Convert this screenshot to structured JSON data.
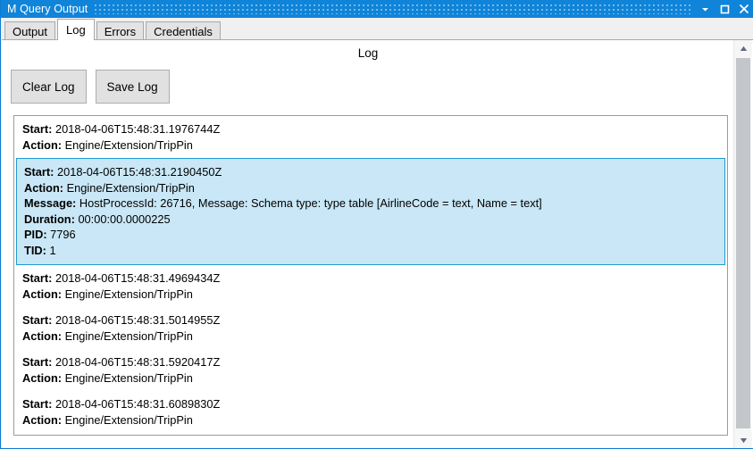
{
  "window": {
    "title": "M Query Output",
    "controls": [
      {
        "name": "minimize-button",
        "glyph": "chevron-down"
      },
      {
        "name": "maximize-button",
        "glyph": "square"
      },
      {
        "name": "close-button",
        "glyph": "x"
      }
    ]
  },
  "tabs": [
    {
      "label": "Output",
      "active": false
    },
    {
      "label": "Log",
      "active": true
    },
    {
      "label": "Errors",
      "active": false
    },
    {
      "label": "Credentials",
      "active": false
    }
  ],
  "page": {
    "heading": "Log"
  },
  "toolbar": {
    "clear_log_label": "Clear Log",
    "save_log_label": "Save Log"
  },
  "labels": {
    "start": "Start:",
    "action": "Action:",
    "message": "Message:",
    "duration": "Duration:",
    "pid": "PID:",
    "tid": "TID:"
  },
  "log_entries": [
    {
      "selected": false,
      "start": "2018-04-06T15:48:31.1976744Z",
      "action": "Engine/Extension/TripPin"
    },
    {
      "selected": true,
      "start": "2018-04-06T15:48:31.2190450Z",
      "action": "Engine/Extension/TripPin",
      "message": "HostProcessId: 26716, Message: Schema type: type table [AirlineCode = text, Name = text]",
      "duration": "00:00:00.0000225",
      "pid": "7796",
      "tid": "1"
    },
    {
      "selected": false,
      "start": "2018-04-06T15:48:31.4969434Z",
      "action": "Engine/Extension/TripPin"
    },
    {
      "selected": false,
      "start": "2018-04-06T15:48:31.5014955Z",
      "action": "Engine/Extension/TripPin"
    },
    {
      "selected": false,
      "start": "2018-04-06T15:48:31.5920417Z",
      "action": "Engine/Extension/TripPin"
    },
    {
      "selected": false,
      "start": "2018-04-06T15:48:31.6089830Z",
      "action": "Engine/Extension/TripPin"
    }
  ],
  "colors": {
    "titlebar": "#1084d8",
    "selection_fill": "#c9e7f6",
    "selection_border": "#1f9bd1",
    "button_face": "#e1e1e1",
    "scrollbar_thumb": "#c3c6ca"
  }
}
